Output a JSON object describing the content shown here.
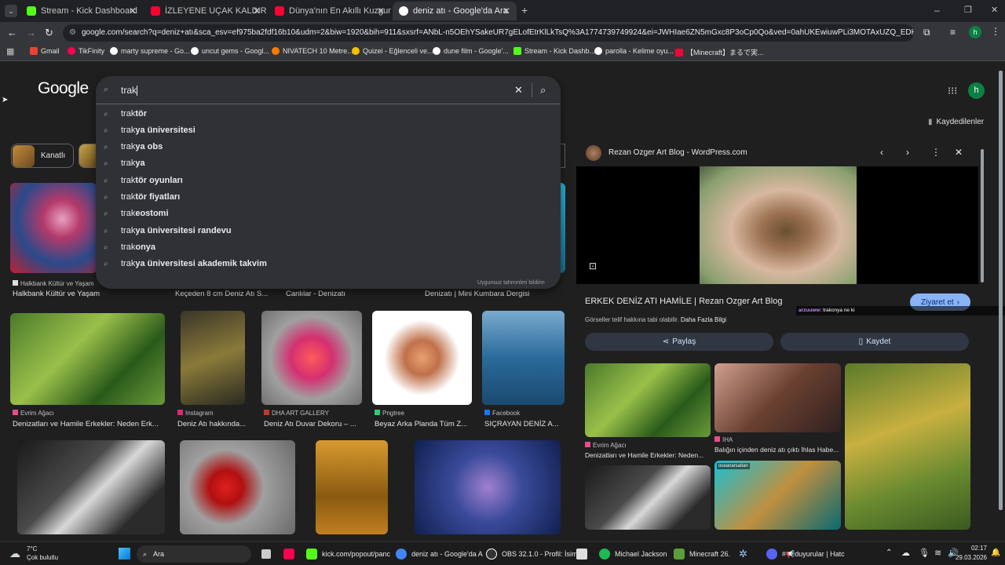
{
  "tabs": [
    {
      "label": "Stream - Kick Dashboard",
      "color": "#53fc18"
    },
    {
      "label": "İZLEYENE UÇAK KALDIRMAYI Ö",
      "color": "#ff0033"
    },
    {
      "label": "Dünya'nın En Akıllı Kuzgununu",
      "color": "#ff0033"
    },
    {
      "label": "deniz atı - Google'da Ara",
      "color": "#ffffff"
    }
  ],
  "address_bar": {
    "url": "google.com/search?q=deniz+atı&sca_esv=ef975ba2fdf16b10&udm=2&biw=1920&bih=911&sxsrf=ANbL-n5OEhYSakeUR7gELofEtrKlLkTsQ%3A1774739749924&ei=JWHIae6ZN5mGxc8P3oCp0Qo&ved=0ahUKEwiuwPLi3MOTAxUZQ_EDHV5AKqoQ4..."
  },
  "bookmarks": [
    {
      "label": "Gmail",
      "color": "#ea4335"
    },
    {
      "label": "TikFinity",
      "color": "#ff0050"
    },
    {
      "label": "marty supreme - Go...",
      "color": "#ffffff"
    },
    {
      "label": "uncut gems - Googl...",
      "color": "#ffffff"
    },
    {
      "label": "NIVATECH 10 Metre...",
      "color": "#ff7a00"
    },
    {
      "label": "Quizei - Eğlenceli ve...",
      "color": "#f5c000"
    },
    {
      "label": "dune film - Google'...",
      "color": "#ffffff"
    },
    {
      "label": "Stream - Kick Dashb...",
      "color": "#53fc18"
    },
    {
      "label": "parolla - Kelime oyu...",
      "color": "#ffffff"
    },
    {
      "label": "【Minecraft】まるで実...",
      "color": "#ff0033"
    }
  ],
  "google": {
    "logo": "Google",
    "avatar_letter": "h",
    "saved_label": "Kaydedilenler",
    "filter_chip": "Kanatlı"
  },
  "search": {
    "query": "trak",
    "suggestions": [
      {
        "typed": "trak",
        "rest": "tör"
      },
      {
        "typed": "trak",
        "rest": "ya üniversitesi"
      },
      {
        "typed": "trak",
        "rest": "ya obs"
      },
      {
        "typed": "trak",
        "rest": "ya"
      },
      {
        "typed": "trak",
        "rest": "tör oyunları"
      },
      {
        "typed": "trak",
        "rest": "tör fiyatları"
      },
      {
        "typed": "trak",
        "rest": "eostomi"
      },
      {
        "typed": "trak",
        "rest": "ya üniversitesi randevu"
      },
      {
        "typed": "trak",
        "rest": "onya"
      },
      {
        "typed": "trak",
        "rest": "ya üniversitesi akademik takvim"
      }
    ],
    "report_link": "Uygunsuz tahminleri bildirin"
  },
  "row1_captions": [
    {
      "source": "Halkbank Kültür ve Yaşam",
      "title": "Halkbank Kültür ve Yaşam"
    },
    {
      "source": "",
      "title": "Keçeden 8 cm Deniz Atı S..."
    },
    {
      "source": "",
      "title": "Canlılar - Denizatı"
    },
    {
      "source": "",
      "title": "Denizatı | Mini Kumbara Dergisi"
    }
  ],
  "row2": [
    {
      "source": "Evrim Ağacı",
      "title": "Denizatları ve Hamile Erkekler: Neden Erk...",
      "src_color": "#e94c89"
    },
    {
      "source": "Instagram",
      "title": "Deniz Atı hakkında...",
      "src_color": "#d62976"
    },
    {
      "source": "DHA ART GALLERY",
      "title": "Deniz Atı Duvar Dekoru – ...",
      "src_color": "#c0392b"
    },
    {
      "source": "Pngtree",
      "title": "Beyaz Arka Planda Tüm Z...",
      "src_color": "#2ecc71"
    },
    {
      "source": "Facebook",
      "title": "SIÇRAYAN DENİZ A...",
      "src_color": "#1877f2"
    }
  ],
  "side_panel": {
    "site": "Rezan Ozger Art Blog - WordPress.com",
    "title": "ERKEK DENİZ ATI HAMİLE | Rezan Ozger Art Blog",
    "visit_button": "Ziyaret et",
    "copyright": "Görseller telif hakkına tabi olabilir.",
    "more_info": "Daha Fazla Bilgi",
    "share_button": "Paylaş",
    "save_button": "Kaydet",
    "chat_user": "arzuuww",
    "chat_message": ": trakonya ne ki",
    "related": [
      {
        "source": "Evrim Ağacı",
        "title": "Denizatları ve Hamile Erkekler: Neden..."
      },
      {
        "source": "IHA",
        "title": "Balığın içinden deniz atı çıktı İhlas Habe..."
      }
    ],
    "thumb_label": "oceanarsaitan"
  },
  "taskbar": {
    "weather_temp": "7°C",
    "weather_desc": "Çok bulutlu",
    "search_label": "Ara",
    "apps": [
      {
        "label": "kick.com/popout/panc",
        "color": "#53fc18"
      },
      {
        "label": "deniz atı - Google'da A",
        "color": "#4285f4"
      },
      {
        "label": "OBS 32.1.0 - Profil: İsim",
        "color": "#ffffff"
      },
      {
        "label": "Michael Jackson",
        "color": "#1db954"
      },
      {
        "label": "Minecraft 26.",
        "color": "#5a9e3a"
      },
      {
        "label": "#📢duyurular | Hatc",
        "color": "#5865f2"
      }
    ],
    "time": "02:17",
    "date": "29.03.2026"
  }
}
